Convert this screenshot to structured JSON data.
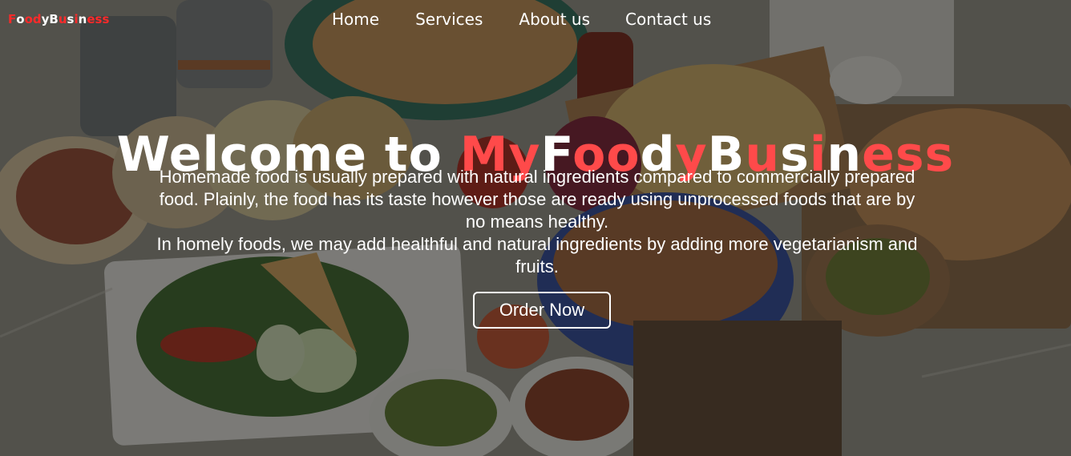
{
  "brand": {
    "letters": [
      {
        "ch": "F",
        "color": "#ff2a2a"
      },
      {
        "ch": "o",
        "color": "#ffffff"
      },
      {
        "ch": "o",
        "color": "#ff2a2a"
      },
      {
        "ch": "d",
        "color": "#ff2a2a"
      },
      {
        "ch": "y",
        "color": "#ffffff"
      },
      {
        "ch": "B",
        "color": "#ffffff"
      },
      {
        "ch": "u",
        "color": "#ff2a2a"
      },
      {
        "ch": "s",
        "color": "#ffffff"
      },
      {
        "ch": "i",
        "color": "#ff2a2a"
      },
      {
        "ch": "n",
        "color": "#ffffff"
      },
      {
        "ch": "e",
        "color": "#ff2a2a"
      },
      {
        "ch": "s",
        "color": "#ff2a2a"
      },
      {
        "ch": "s",
        "color": "#ff2a2a"
      }
    ]
  },
  "nav": {
    "home": "Home",
    "services": "Services",
    "about": "About us",
    "contact": "Contact us"
  },
  "hero": {
    "title_prefix": "Welcome to",
    "title_brand_letters": [
      {
        "ch": "M",
        "color": "#ff4a4a"
      },
      {
        "ch": "y",
        "color": "#ff4a4a"
      },
      {
        "ch": "F",
        "color": "#ffffff"
      },
      {
        "ch": "o",
        "color": "#ff4a4a"
      },
      {
        "ch": "o",
        "color": "#ff4a4a"
      },
      {
        "ch": "d",
        "color": "#ffffff"
      },
      {
        "ch": "y",
        "color": "#ff4a4a"
      },
      {
        "ch": "B",
        "color": "#ffffff"
      },
      {
        "ch": "u",
        "color": "#ff4a4a"
      },
      {
        "ch": "s",
        "color": "#ffffff"
      },
      {
        "ch": "i",
        "color": "#ff4a4a"
      },
      {
        "ch": "n",
        "color": "#ffffff"
      },
      {
        "ch": "e",
        "color": "#ff4a4a"
      },
      {
        "ch": "s",
        "color": "#ff4a4a"
      },
      {
        "ch": "s",
        "color": "#ff4a4a"
      }
    ],
    "paragraph_1": "Homemade food is usually prepared with natural ingredients compared to commercially prepared food. Plainly, the food has its taste however those are ready using unprocessed foods that are by no means healthy.",
    "paragraph_2": "In homely foods, we may add healthful and natural ingredients by adding more vegetarianism and fruits.",
    "cta_label": "Order Now"
  }
}
